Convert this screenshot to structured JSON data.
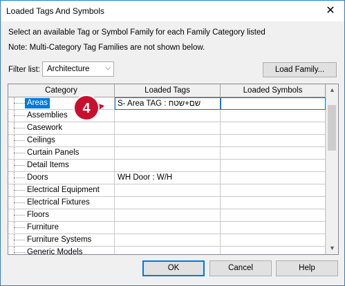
{
  "window": {
    "title": "Loaded Tags And Symbols",
    "close_glyph": "✕"
  },
  "instructions": {
    "line1": "Select an available Tag or Symbol Family for each Family Category listed",
    "line2": "Note: Multi-Category Tag Families are not shown below."
  },
  "filter": {
    "label": "Filter list:",
    "selected": "Architecture",
    "chevron": "⌵"
  },
  "buttons": {
    "load_family": "Load Family...",
    "ok": "OK",
    "cancel": "Cancel",
    "help": "Help"
  },
  "grid": {
    "headers": [
      "Category",
      "Loaded Tags",
      "Loaded Symbols"
    ],
    "rows": [
      {
        "category": "Areas",
        "tags": "S- Area TAG : שם+שטח",
        "symbols": ""
      },
      {
        "category": "Assemblies",
        "tags": "",
        "symbols": ""
      },
      {
        "category": "Casework",
        "tags": "",
        "symbols": ""
      },
      {
        "category": "Ceilings",
        "tags": "",
        "symbols": ""
      },
      {
        "category": "Curtain Panels",
        "tags": "",
        "symbols": ""
      },
      {
        "category": "Detail Items",
        "tags": "",
        "symbols": ""
      },
      {
        "category": "Doors",
        "tags": "WH Door : W/H",
        "symbols": ""
      },
      {
        "category": "Electrical Equipment",
        "tags": "",
        "symbols": ""
      },
      {
        "category": "Electrical Fixtures",
        "tags": "",
        "symbols": ""
      },
      {
        "category": "Floors",
        "tags": "",
        "symbols": ""
      },
      {
        "category": "Furniture",
        "tags": "",
        "symbols": ""
      },
      {
        "category": "Furniture Systems",
        "tags": "",
        "symbols": ""
      },
      {
        "category": "Generic Models",
        "tags": "",
        "symbols": ""
      }
    ]
  },
  "callout": {
    "number": "4",
    "color": "#c8102e"
  },
  "colors": {
    "selection": "#0078d7",
    "window_border": "#1883d7"
  }
}
